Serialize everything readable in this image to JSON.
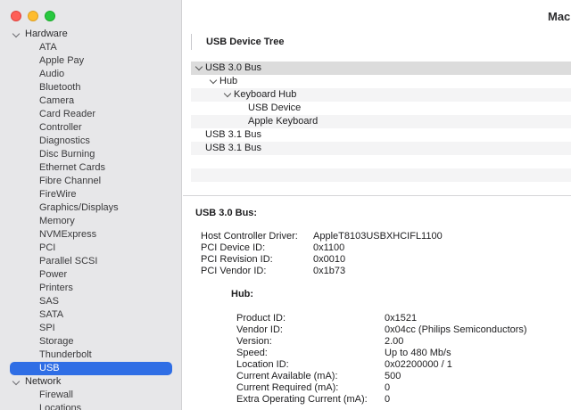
{
  "window": {
    "title": "Mac"
  },
  "sidebar": {
    "groups": [
      {
        "label": "Hardware",
        "expanded": true
      },
      {
        "label": "Network",
        "expanded": true
      }
    ],
    "hardware_items": [
      "ATA",
      "Apple Pay",
      "Audio",
      "Bluetooth",
      "Camera",
      "Card Reader",
      "Controller",
      "Diagnostics",
      "Disc Burning",
      "Ethernet Cards",
      "Fibre Channel",
      "FireWire",
      "Graphics/Displays",
      "Memory",
      "NVMExpress",
      "PCI",
      "Parallel SCSI",
      "Power",
      "Printers",
      "SAS",
      "SATA",
      "SPI",
      "Storage",
      "Thunderbolt",
      "USB"
    ],
    "selected_item": "USB",
    "network_items": [
      "Firewall",
      "Locations"
    ]
  },
  "tree": {
    "header": "USB Device Tree",
    "rows": [
      {
        "label": "USB 3.0 Bus",
        "level": 0,
        "expanded": true,
        "selected": true
      },
      {
        "label": "Hub",
        "level": 1,
        "expanded": true
      },
      {
        "label": "Keyboard Hub",
        "level": 2,
        "expanded": true
      },
      {
        "label": "USB Device",
        "level": 3
      },
      {
        "label": "Apple Keyboard",
        "level": 3
      },
      {
        "label": "USB 3.1 Bus",
        "level": 0
      },
      {
        "label": "USB 3.1 Bus",
        "level": 0
      },
      {
        "label": "",
        "level": 0
      },
      {
        "label": "",
        "level": 0
      },
      {
        "label": "",
        "level": 0
      }
    ]
  },
  "details": {
    "heading": "USB 3.0 Bus:",
    "controller": [
      {
        "key": "Host Controller Driver:",
        "value": "AppleT8103USBXHCIFL1100"
      },
      {
        "key": "PCI Device ID:",
        "value": "0x1100"
      },
      {
        "key": "PCI Revision ID:",
        "value": "0x0010"
      },
      {
        "key": "PCI Vendor ID:",
        "value": "0x1b73"
      }
    ],
    "hub_heading": "Hub:",
    "hub": [
      {
        "key": "Product ID:",
        "value": "0x1521"
      },
      {
        "key": "Vendor ID:",
        "value": "0x04cc  (Philips Semiconductors)"
      },
      {
        "key": "Version:",
        "value": "2.00"
      },
      {
        "key": "Speed:",
        "value": "Up to 480 Mb/s"
      },
      {
        "key": "Location ID:",
        "value": "0x02200000 / 1"
      },
      {
        "key": "Current Available (mA):",
        "value": "500"
      },
      {
        "key": "Current Required (mA):",
        "value": "0"
      },
      {
        "key": "Extra Operating Current (mA):",
        "value": "0"
      }
    ]
  }
}
